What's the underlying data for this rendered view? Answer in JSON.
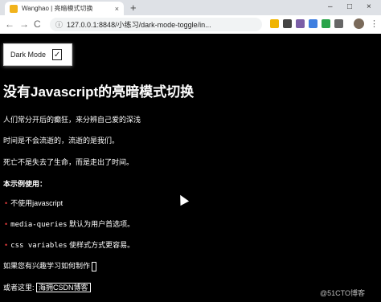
{
  "browser": {
    "tab_title": "Wanghao | 亮暗模式切换",
    "tab_close": "×",
    "new_tab": "+",
    "window_min": "–",
    "window_max": "□",
    "window_close": "×",
    "back": "←",
    "forward": "→",
    "reload": "C",
    "info": "ⓘ",
    "url": "127.0.0.1:8848/小练习/dark-mode-toggle/in...",
    "menu": "⋮"
  },
  "page": {
    "toggle_label": "Dark Mode",
    "toggle_check": "✓",
    "heading": "没有Javascript的亮暗模式切换",
    "line1": "人们常分开后的癫狂，来分辨自己爱的深浅",
    "line2": "时间是不会流逝的，流逝的是我们。",
    "line3": "死亡不是失去了生命，而是走出了时间。",
    "example_title": "本示例使用：",
    "items": [
      {
        "bullet": "•",
        "code": "",
        "text": "不使用javascript"
      },
      {
        "bullet": "•",
        "code": "media-queries",
        "text": " 默认为用户首选项。"
      },
      {
        "bullet": "•",
        "code": "css variables",
        "text": " 使样式方式更容易。"
      }
    ],
    "learn_text": "如果您有兴趣学习如何制作",
    "or_here": "或者这里: ",
    "csdn_link": "海拥CSDN博客",
    "watermark": "@51CTO博客"
  }
}
